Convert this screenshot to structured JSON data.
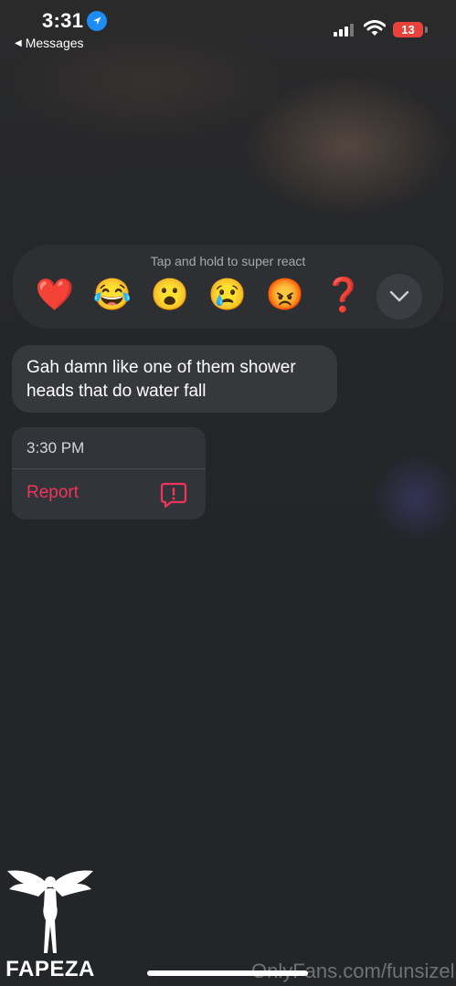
{
  "status_bar": {
    "time": "3:31",
    "back_label": "Messages",
    "battery": "13"
  },
  "reactions": {
    "hint": "Tap and hold to super react",
    "emojis": [
      "❤️",
      "😂",
      "😮",
      "😢",
      "😡",
      "❓"
    ]
  },
  "message": {
    "text": "Gah damn like one of them shower heads that do water fall"
  },
  "context_menu": {
    "time": "3:30 PM",
    "report_label": "Report"
  },
  "watermark": {
    "url": "OnlyFans.com/funsizeliz",
    "logo_text": "FAPEZA"
  },
  "colors": {
    "accent_report": "#f0345c",
    "battery_low": "#e8423c",
    "location_blue": "#1e8cf5"
  },
  "icons": [
    "location-arrow-icon",
    "back-triangle-icon",
    "cellular-signal-icon",
    "wifi-icon",
    "battery-icon",
    "chevron-down-icon",
    "report-exclamation-icon",
    "angel-logo-icon"
  ]
}
